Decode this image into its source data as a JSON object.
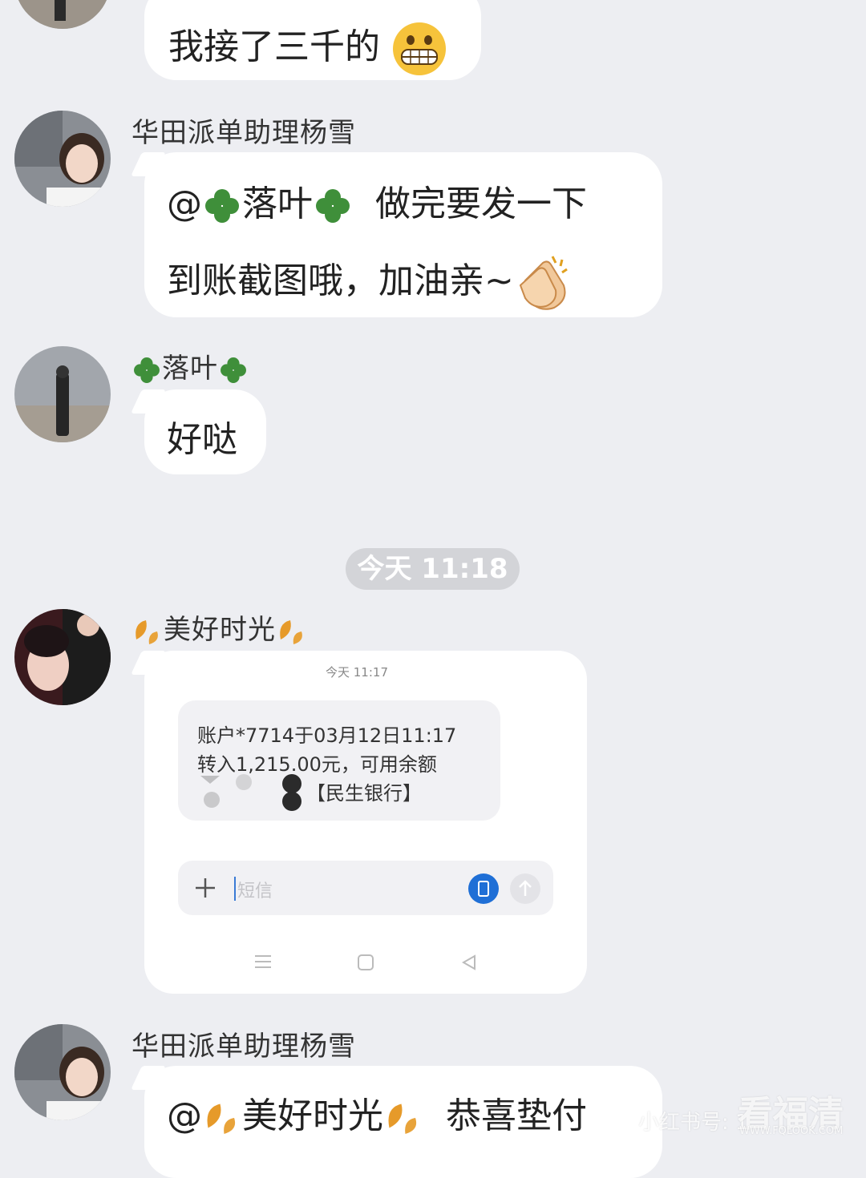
{
  "messages": {
    "m1": {
      "text": "我接了三千的"
    },
    "m2": {
      "sender": "华田派单助理杨雪",
      "mention": "@",
      "mention_name": "落叶",
      "line1_rest": "做完要发一下",
      "line2": "到账截图哦，加油亲~"
    },
    "m3": {
      "sender": "落叶",
      "text": "好哒"
    },
    "time_divider": "今天 11:18",
    "m4": {
      "sender": "美好时光",
      "screenshot": {
        "time": "今天 11:17",
        "sms_line1": "账户*7714于03月12日11:17",
        "sms_line2": "转入1,215.00元，可用余额",
        "sms_bank": "【民生银行】",
        "input_placeholder": "短信"
      }
    },
    "m5": {
      "sender": "华田派单助理杨雪",
      "mention": "@",
      "mention_name": "美好时光",
      "rest": "恭喜垫付"
    }
  },
  "watermark": {
    "xhs": "小红书号: 1",
    "site": "看福清",
    "url": "WWW.FQLOOK.COM"
  },
  "colors": {
    "background": "#edeef2",
    "bubble": "#ffffff",
    "clover": "#3f8f3a",
    "leaf": "#e69a2a",
    "pill": "#d3d4d8"
  }
}
